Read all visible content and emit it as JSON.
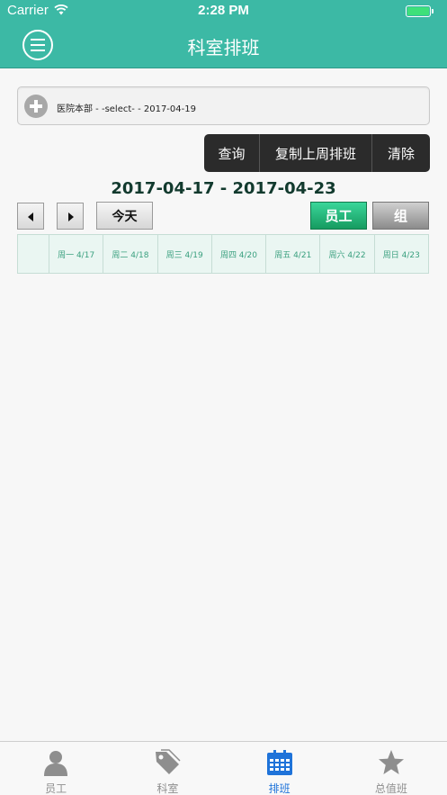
{
  "status_bar": {
    "carrier": "Carrier",
    "time": "2:28 PM"
  },
  "nav": {
    "title": "科室排班"
  },
  "selector": {
    "text": "医院本部 - -select- - 2017-04-19"
  },
  "actions": {
    "query": "查询",
    "copy_last_week": "复制上周排班",
    "clear": "清除"
  },
  "week_range": "2017-04-17 - 2017-04-23",
  "controls": {
    "today": "今天",
    "view_staff": "员工",
    "view_group": "组"
  },
  "days": [
    "周一 4/17",
    "周二 4/18",
    "周三 4/19",
    "周四 4/20",
    "周五 4/21",
    "周六 4/22",
    "周日 4/23"
  ],
  "tabs": [
    {
      "label": "员工",
      "icon": "person-icon"
    },
    {
      "label": "科室",
      "icon": "tag-icon"
    },
    {
      "label": "排班",
      "icon": "calendar-icon"
    },
    {
      "label": "总值班",
      "icon": "star-icon"
    }
  ],
  "colors": {
    "nav": "#3cb9a5",
    "active_tab": "#1f73d9",
    "staff_button": "#1fb877"
  }
}
